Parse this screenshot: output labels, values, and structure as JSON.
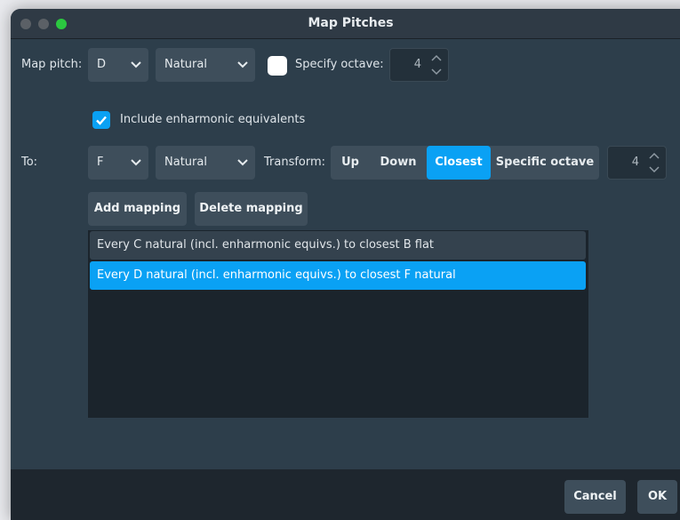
{
  "window": {
    "title": "Map Pitches"
  },
  "map_pitch": {
    "label": "Map pitch:",
    "note": "D",
    "accidental": "Natural",
    "specify_octave_checked": false,
    "specify_octave_label": "Specify octave:",
    "octave_value": "4"
  },
  "enharmonic": {
    "checked": true,
    "label": "Include enharmonic equivalents"
  },
  "to": {
    "label": "To:",
    "note": "F",
    "accidental": "Natural",
    "transform_label": "Transform:",
    "transform_options": [
      "Up",
      "Down",
      "Closest",
      "Specific octave"
    ],
    "transform_selected": "Closest",
    "octave_value": "4"
  },
  "buttons": {
    "add": "Add mapping",
    "delete": "Delete mapping",
    "cancel": "Cancel",
    "ok": "OK"
  },
  "mappings": [
    {
      "text": "Every C natural (incl. enharmonic equivs.) to closest B flat",
      "selected": false
    },
    {
      "text": "Every D natural (incl. enharmonic equivs.) to closest F natural",
      "selected": true
    }
  ],
  "colors": {
    "accent": "#0aa1f4",
    "window_bg": "#2d3e4b",
    "control_bg": "#3e4e5b",
    "list_bg": "#1b242c"
  }
}
